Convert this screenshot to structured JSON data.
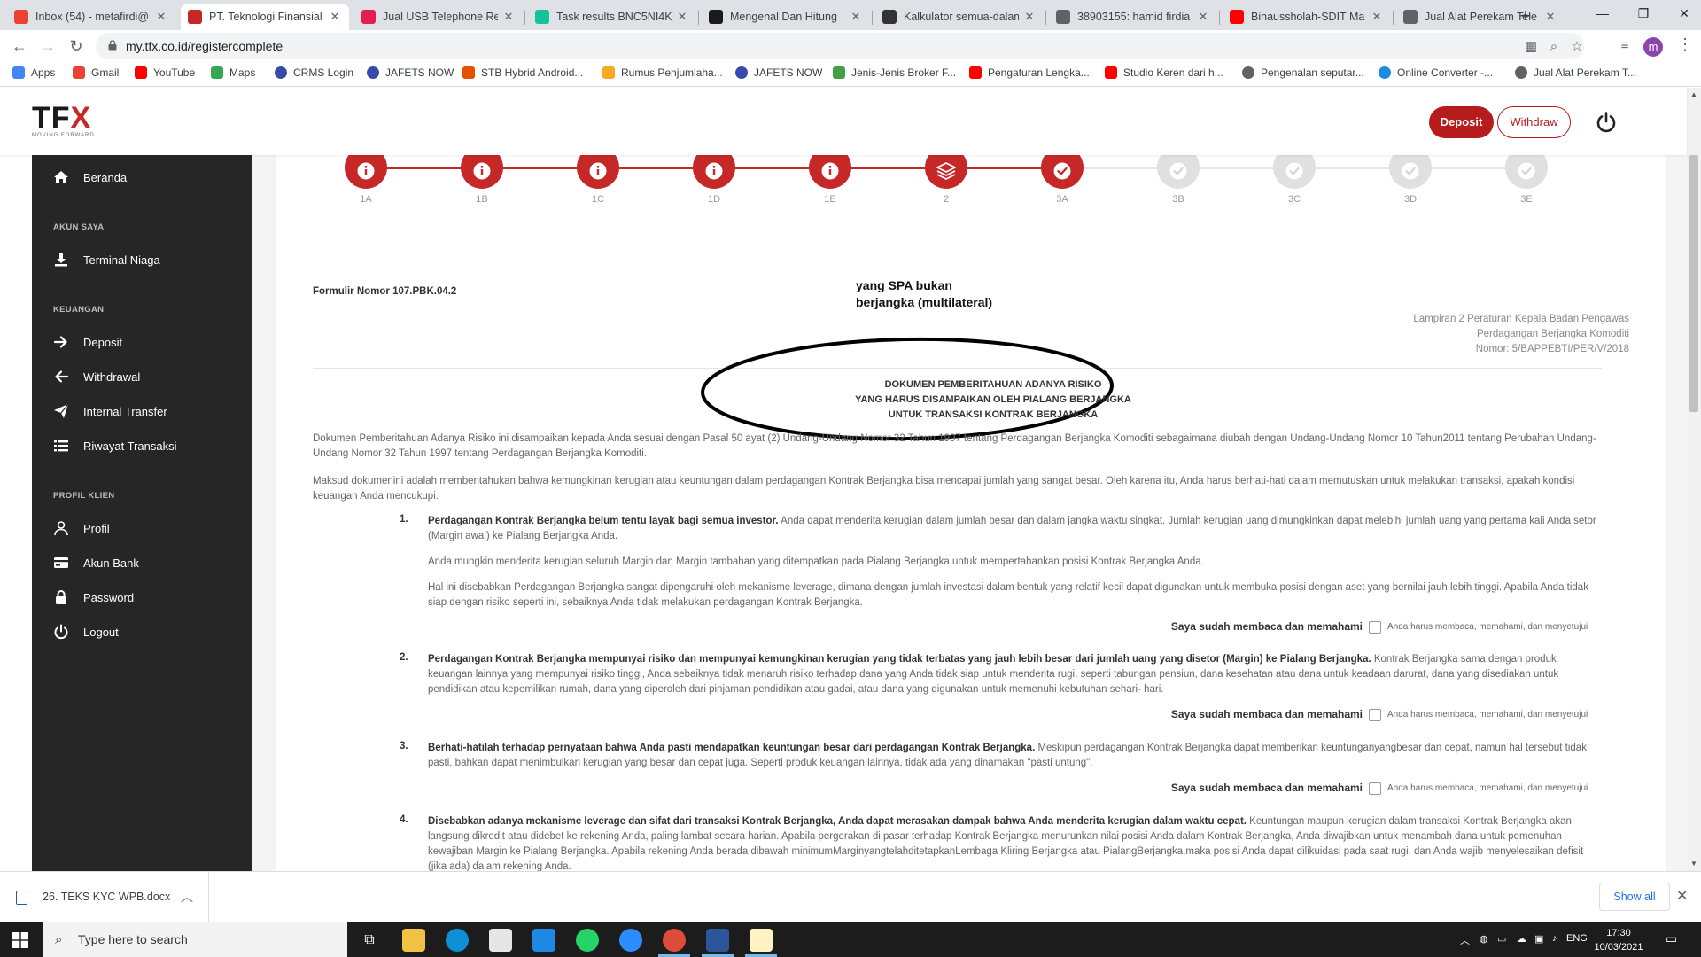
{
  "browser": {
    "tabs": [
      {
        "title": "Inbox (54) - metafirdi@",
        "favicon": "gmail-icon",
        "color": "#ea4335"
      },
      {
        "title": "PT. Teknologi Finansial",
        "favicon": "tfx-icon",
        "color": "#c62828",
        "active": true
      },
      {
        "title": "Jual USB Telephone Rec",
        "favicon": "bukalapak-icon",
        "color": "#e31e52"
      },
      {
        "title": "Task results BNC5NI4K",
        "favicon": "grammarly-icon",
        "color": "#15c39a"
      },
      {
        "title": "Mengenal Dan Hitung",
        "favicon": "web-icon",
        "color": "#1a1a1a"
      },
      {
        "title": "Kalkulator semua-dalam",
        "favicon": "calc-icon",
        "color": "#333333"
      },
      {
        "title": "38903155: hamid firdia",
        "favicon": "globe-icon",
        "color": "#5f6368"
      },
      {
        "title": "Binaussholah-SDIT Ma",
        "favicon": "youtube-icon",
        "color": "#ff0000"
      },
      {
        "title": "Jual Alat Perekam Tele",
        "favicon": "globe-icon",
        "color": "#5f6368"
      }
    ],
    "new_tab": "+",
    "window_controls": {
      "minimize": "—",
      "maximize": "❐",
      "close": "✕"
    },
    "url": "my.tfx.co.id/registercomplete",
    "profile_initial": "m",
    "bookmarks": [
      {
        "label": "Apps",
        "icon": "apps-grid-icon",
        "color": "#4285f4"
      },
      {
        "label": "Gmail",
        "icon": "gmail-icon",
        "color": "#ea4335"
      },
      {
        "label": "YouTube",
        "icon": "youtube-icon",
        "color": "#ff0000"
      },
      {
        "label": "Maps",
        "icon": "maps-icon",
        "color": "#34a853"
      },
      {
        "label": "CRMS Login",
        "icon": "crms-icon",
        "color": "#3949ab"
      },
      {
        "label": "JAFETS NOW",
        "icon": "jafets-icon",
        "color": "#3949ab"
      },
      {
        "label": "STB Hybrid Android...",
        "icon": "shop-icon",
        "color": "#e65100"
      },
      {
        "label": "Rumus Penjumlaha...",
        "icon": "doc-icon",
        "color": "#f9a825"
      },
      {
        "label": "JAFETS NOW",
        "icon": "jafets-icon",
        "color": "#3949ab"
      },
      {
        "label": "Jenis-Jenis Broker F...",
        "icon": "broker-icon",
        "color": "#43a047"
      },
      {
        "label": "Pengaturan Lengka...",
        "icon": "youtube-icon",
        "color": "#ff0000"
      },
      {
        "label": "Studio Keren dari h...",
        "icon": "youtube-icon",
        "color": "#ff0000"
      },
      {
        "label": "Pengenalan seputar...",
        "icon": "globe-icon",
        "color": "#5f6368"
      },
      {
        "label": "Online Converter -...",
        "icon": "converter-icon",
        "color": "#1e88e5"
      },
      {
        "label": "Jual Alat Perekam T...",
        "icon": "globe-icon",
        "color": "#5f6368"
      }
    ]
  },
  "header": {
    "logo_text_a": "TF",
    "logo_text_b": "X",
    "logo_tagline": "MOVING FORWARD",
    "deposit_label": "Deposit",
    "withdraw_label": "Withdraw",
    "brand_color": "#b71c1c"
  },
  "sidebar": {
    "home_label": "Beranda",
    "sections": [
      {
        "title": "AKUN SAYA",
        "items": [
          {
            "label": "Terminal Niaga",
            "icon": "download-icon"
          }
        ]
      },
      {
        "title": "KEUANGAN",
        "items": [
          {
            "label": "Deposit",
            "icon": "arrow-right-icon"
          },
          {
            "label": "Withdrawal",
            "icon": "arrow-left-icon"
          },
          {
            "label": "Internal Transfer",
            "icon": "paper-plane-icon"
          },
          {
            "label": "Riwayat Transaksi",
            "icon": "list-icon"
          }
        ]
      },
      {
        "title": "PROFIL KLIEN",
        "items": [
          {
            "label": "Profil",
            "icon": "user-icon"
          },
          {
            "label": "Akun Bank",
            "icon": "credit-card-icon"
          },
          {
            "label": "Password",
            "icon": "lock-icon"
          },
          {
            "label": "Logout",
            "icon": "power-icon"
          }
        ]
      }
    ]
  },
  "steps": [
    {
      "label": "1A",
      "state": "info"
    },
    {
      "label": "1B",
      "state": "info"
    },
    {
      "label": "1C",
      "state": "info"
    },
    {
      "label": "1D",
      "state": "info"
    },
    {
      "label": "1E",
      "state": "info"
    },
    {
      "label": "2",
      "state": "current"
    },
    {
      "label": "3A",
      "state": "done"
    },
    {
      "label": "3B",
      "state": "pending"
    },
    {
      "label": "3C",
      "state": "pending"
    },
    {
      "label": "3D",
      "state": "pending"
    },
    {
      "label": "3E",
      "state": "pending"
    }
  ],
  "document": {
    "form_number": "Formulir Nomor 107.PBK.04.2",
    "annotation_line1": "yang SPA bukan",
    "annotation_line2": "berjangka (multilateral)",
    "lampiran_line1": "Lampiran 2 Peraturan Kepala Badan Pengawas",
    "lampiran_line2": "Perdagangan Berjangka Komoditi",
    "lampiran_line3": "Nomor: 5/BAPPEBTI/PER/V/2018",
    "title_line1": "DOKUMEN PEMBERITAHUAN ADANYA RISIKO",
    "title_line2": "YANG HARUS DISAMPAIKAN OLEH PIALANG BERJANGKA",
    "title_line3": "UNTUK TRANSAKSI KONTRAK BERJANGKA",
    "intro_1": "Dokumen Pemberitahuan Adanya Risiko ini disampaikan kepada Anda sesuai dengan Pasal 50 ayat (2) Undang-Undang Nomor 32 Tahun 1997 tentang Perdagangan Berjangka Komoditi sebagaimana diubah dengan Undang-Undang Nomor 10 Tahun2011 tentang Perubahan Undang-Undang Nomor 32 Tahun 1997 tentang Perdagangan Berjangka Komoditi.",
    "intro_2": "Maksud dokumenini adalah memberitahukan bahwa kemungkinan kerugian atau keuntungan dalam perdagangan Kontrak Berjangka bisa mencapai jumlah yang sangat besar. Oleh karena itu, Anda harus berhati-hati dalam memutuskan untuk melakukan transaksi, apakah kondisi keuangan Anda mencukupi.",
    "items": [
      {
        "num": "1.",
        "bold": "Perdagangan Kontrak Berjangka belum tentu layak bagi semua investor.",
        "text": " Anda dapat menderita kerugian dalam jumlah besar dan dalam jangka waktu singkat. Jumlah kerugian uang dimungkinkan dapat melebihi jumlah uang yang pertama kali Anda setor (Margin awal) ke Pialang Berjangka Anda.",
        "extra1": "Anda mungkin menderita kerugian seluruh Margin dan Margin tambahan yang ditempatkan pada Pialang Berjangka untuk mempertahankan posisi Kontrak Berjangka Anda.",
        "extra2": "Hal ini disebabkan Perdagangan Berjangka sangat dipengaruhi oleh mekanisme leverage, dimana dengan jumlah investasi dalam bentuk yang relatif kecil dapat digunakan untuk membuka posisi dengan aset yang bernilai jauh lebih tinggi. Apabila Anda tidak siap dengan risiko seperti ini, sebaiknya Anda tidak melakukan perdagangan Kontrak Berjangka."
      },
      {
        "num": "2.",
        "bold": "Perdagangan Kontrak Berjangka mempunyai risiko dan mempunyai kemungkinan kerugian yang tidak terbatas yang jauh lebih besar dari jumlah uang yang disetor (Margin) ke Pialang Berjangka.",
        "text": " Kontrak Berjangka sama dengan produk keuangan lainnya yang mempunyai risiko tinggi, Anda sebaiknya tidak menaruh risiko terhadap dana yang Anda tidak siap untuk menderita rugi, seperti tabungan pensiun, dana kesehatan atau dana untuk keadaan darurat, dana yang disediakan untuk pendidikan atau kepemilikan rumah, dana yang diperoleh dari pinjaman pendidikan atau gadai, atau dana yang digunakan untuk memenuhi kebutuhan sehari- hari."
      },
      {
        "num": "3.",
        "bold": "Berhati-hatilah terhadap pernyataan bahwa Anda pasti mendapatkan keuntungan besar dari perdagangan Kontrak Berjangka.",
        "text": " Meskipun perdagangan Kontrak Berjangka dapat memberikan keuntunganyangbesar dan cepat, namun hal tersebut tidak pasti, bahkan dapat menimbulkan kerugian yang besar dan cepat juga. Seperti produk keuangan lainnya, tidak ada yang dinamakan \"pasti untung\"."
      },
      {
        "num": "4.",
        "bold": "Disebabkan adanya mekanisme leverage dan sifat dari transaksi Kontrak Berjangka, Anda dapat merasakan dampak bahwa Anda menderita kerugian dalam waktu cepat.",
        "text": " Keuntungan maupun kerugian dalam transaksi Kontrak Berjangka akan langsung dikredit atau didebet ke rekening Anda, paling lambat secara harian. Apabila pergerakan di pasar terhadap Kontrak Berjangka menurunkan nilai posisi Anda dalam Kontrak Berjangka, Anda diwajibkan untuk menambah dana untuk pemenuhan kewajiban Margin ke Pialang Berjangka. Apabila rekening Anda berada dibawah minimumMarginyangtelahditetapkanLembaga Kliring Berjangka atau PialangBerjangka,maka posisi Anda dapat dilikuidasi pada saat rugi, dan Anda wajib menyelesaikan defisit (jika ada) dalam rekening Anda."
      }
    ],
    "confirm_label": "Saya sudah membaca dan memahami",
    "confirm_hint": "Anda harus membaca, memahami, dan menyetujui"
  },
  "download_bar": {
    "file_name": "26. TEKS KYC WPB.docx",
    "show_all_label": "Show all"
  },
  "taskbar": {
    "search_placeholder": "Type here to search",
    "language": "ENG",
    "time": "17:30",
    "date": "10/03/2021"
  }
}
